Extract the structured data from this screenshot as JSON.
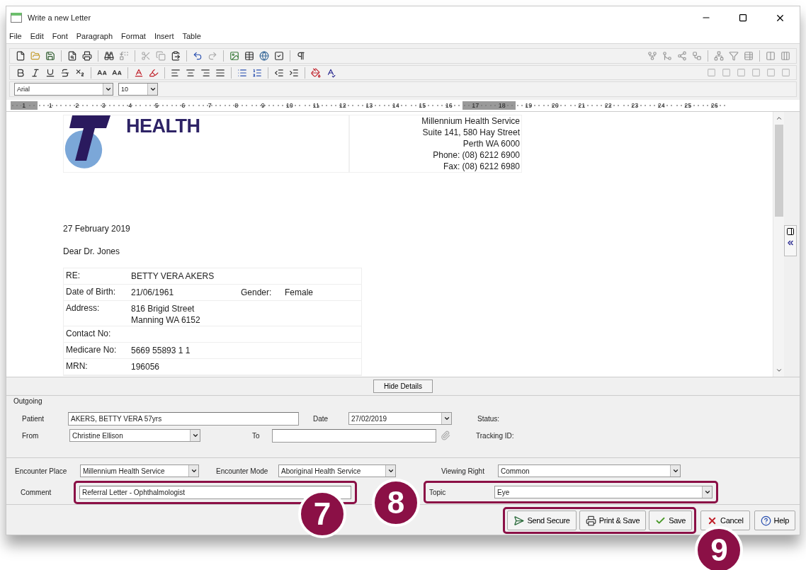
{
  "window": {
    "title": "Write a new Letter"
  },
  "menu": [
    "File",
    "Edit",
    "Font",
    "Paragraph",
    "Format",
    "Insert",
    "Table"
  ],
  "font_bar": {
    "font": "Arial",
    "size": "10"
  },
  "ruler": [
    {
      "label": "1",
      "shaded": true
    },
    {
      "label": "1",
      "shaded": false
    },
    {
      "label": "2",
      "shaded": false
    },
    {
      "label": "3",
      "shaded": false
    },
    {
      "label": "4",
      "shaded": false
    },
    {
      "label": "5",
      "shaded": false
    },
    {
      "label": "6",
      "shaded": false
    },
    {
      "label": "7",
      "shaded": false
    },
    {
      "label": "8",
      "shaded": false
    },
    {
      "label": "9",
      "shaded": false
    },
    {
      "label": "10",
      "shaded": false
    },
    {
      "label": "11",
      "shaded": false
    },
    {
      "label": "12",
      "shaded": false
    },
    {
      "label": "13",
      "shaded": false
    },
    {
      "label": "14",
      "shaded": false
    },
    {
      "label": "15",
      "shaded": false
    },
    {
      "label": "16",
      "shaded": false
    },
    {
      "label": "17",
      "shaded": true
    },
    {
      "label": "18",
      "shaded": true
    },
    {
      "label": "19",
      "shaded": false
    },
    {
      "label": "20",
      "shaded": false
    },
    {
      "label": "21",
      "shaded": false
    },
    {
      "label": "22",
      "shaded": false
    },
    {
      "label": "23",
      "shaded": false
    },
    {
      "label": "24",
      "shaded": false
    },
    {
      "label": "25",
      "shaded": false
    },
    {
      "label": "26",
      "shaded": false
    }
  ],
  "letter": {
    "logo_text": "HEALTH",
    "sender": [
      "Millennium Health Service",
      "Suite 141, 580 Hay Street",
      "Perth WA 6000",
      "Phone: (08) 6212 6900",
      "Fax: (08) 6212 6980"
    ],
    "date": "27 February 2019",
    "salutation": "Dear Dr. Jones",
    "details": [
      {
        "label": "RE:",
        "value": "BETTY VERA AKERS"
      },
      {
        "label": "Date of Birth:",
        "value": "21/06/1961",
        "extra_label": "Gender:",
        "extra_value": "Female"
      },
      {
        "label": "Address:",
        "value": "816 Brigid Street\nManning WA 6152"
      },
      {
        "label": "Contact No:"
      },
      {
        "label": "Medicare No:",
        "value": "5669 55893 1 1"
      },
      {
        "label": "MRN:",
        "value": "196056"
      }
    ]
  },
  "hide_details_button": "Hide Details",
  "outgoing": {
    "title": "Outgoing",
    "patient": {
      "label": "Patient",
      "value": "AKERS, BETTY VERA 57yrs"
    },
    "date": {
      "label": "Date",
      "value": "27/02/2019"
    },
    "status": {
      "label": "Status:"
    },
    "from": {
      "label": "From",
      "value": "Christine Ellison"
    },
    "to": {
      "label": "To"
    },
    "tracking": {
      "label": "Tracking ID:"
    }
  },
  "encounter": {
    "place": {
      "label": "Encounter Place",
      "value": "Millennium Health Service"
    },
    "mode": {
      "label": "Encounter Mode",
      "value": "Aboriginal Health Service"
    },
    "viewing_right": {
      "label": "Viewing Right",
      "value": "Common"
    }
  },
  "comment": {
    "label": "Comment",
    "value": "Referral Letter - Ophthalmologist",
    "callout": "7"
  },
  "topic": {
    "label": "Topic",
    "value": "Eye",
    "callout": "8"
  },
  "callout_group": {
    "callout": "9",
    "buttons": [
      {
        "label": "Send Secure",
        "kind": "send"
      },
      {
        "label": "Print & Save",
        "kind": "print"
      },
      {
        "label": "Save",
        "kind": "save"
      }
    ]
  },
  "buttons": [
    {
      "label": "Cancel",
      "kind": "cancel"
    },
    {
      "label": "Help",
      "kind": "help"
    }
  ]
}
